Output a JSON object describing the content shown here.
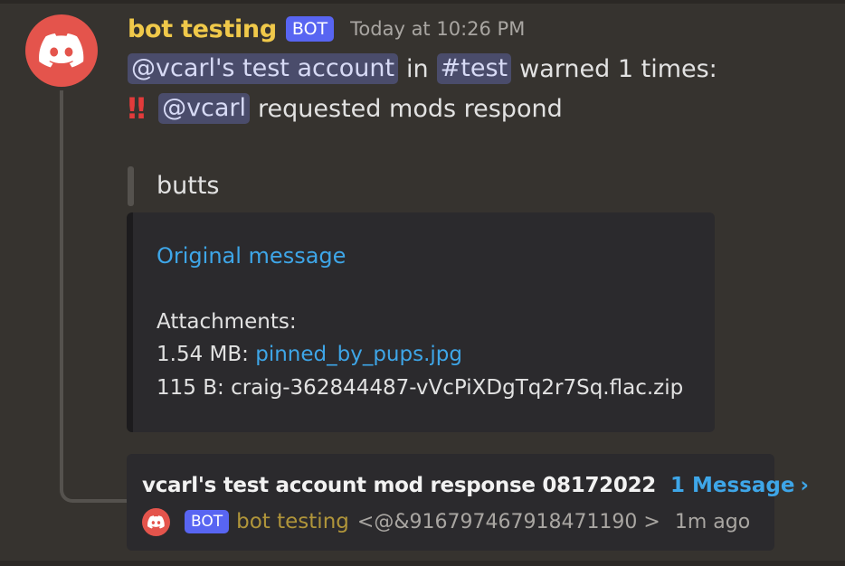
{
  "message": {
    "author": "bot testing",
    "author_color": "#f0c94a",
    "badge": "BOT",
    "badge_color": "#5865f2",
    "timestamp": "Today at 10:26 PM",
    "avatar_icon": "discord-logo-icon",
    "avatar_color": "#e4544c",
    "line1": {
      "user_mention": "@vcarl's test account",
      "connector": "in",
      "channel_mention": "#test",
      "suffix": "warned 1 times:"
    },
    "line2": {
      "alert_icon": "double-exclamation-icon",
      "alert_glyph": "‼",
      "user_mention": "@vcarl",
      "suffix": "requested mods respond"
    },
    "quote": "butts"
  },
  "embed": {
    "link_label": "Original message",
    "attachments_heading": "Attachments:",
    "attachments": [
      {
        "size": "1.54 MB:",
        "name": "pinned_by_pups.jpg",
        "is_link": true
      },
      {
        "size": "115 B:",
        "name": "craig-362844487-vVcPiXDgTq2r7Sq.flac.zip",
        "is_link": false
      }
    ],
    "link_color": "#3ea6e8"
  },
  "thread": {
    "name": "vcarl's test account mod response 08172022",
    "count": "1 Message",
    "chevron": "›",
    "preview": {
      "badge": "BOT",
      "author": "bot testing",
      "text": "<@&916797467918471190 >",
      "time": "1m ago"
    }
  }
}
